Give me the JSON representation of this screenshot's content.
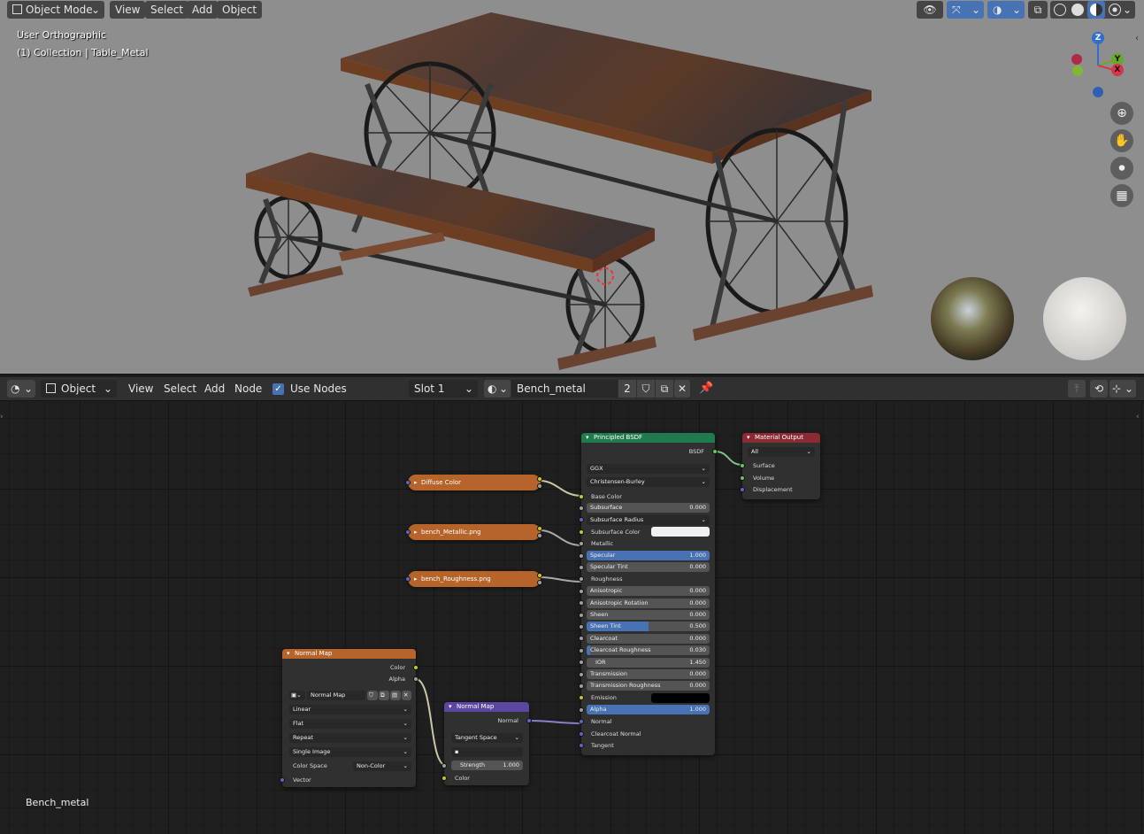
{
  "viewport": {
    "mode": "Object Mode",
    "menus": [
      "View",
      "Select",
      "Add",
      "Object"
    ],
    "view_name": "User Orthographic",
    "collection_info": "(1) Collection | Table_Metal",
    "gizmo": {
      "z": "Z",
      "y": "Y",
      "x": "X"
    }
  },
  "node_editor": {
    "type_value": "Object",
    "menus": [
      "View",
      "Select",
      "Add",
      "Node"
    ],
    "use_nodes_label": "Use Nodes",
    "slot": "Slot 1",
    "material_name": "Bench_metal",
    "user_count": "2",
    "footer_label": "Bench_metal"
  },
  "nodes": {
    "principled": {
      "title": "Principled BSDF",
      "output": "BSDF",
      "distribution": "GGX",
      "subsurface_method": "Christensen-Burley",
      "inputs": [
        {
          "label": "Base Color",
          "kind": "socket"
        },
        {
          "label": "Subsurface",
          "value": "0.000",
          "fill": 0
        },
        {
          "label": "Subsurface Radius",
          "kind": "dropdown"
        },
        {
          "label": "Subsurface Color",
          "kind": "color",
          "color": "#f2f2f2"
        },
        {
          "label": "Metallic",
          "kind": "socket"
        },
        {
          "label": "Specular",
          "value": "1.000",
          "fill": 1
        },
        {
          "label": "Specular Tint",
          "value": "0.000",
          "fill": 0
        },
        {
          "label": "Roughness",
          "kind": "socket"
        },
        {
          "label": "Anisotropic",
          "value": "0.000",
          "fill": 0
        },
        {
          "label": "Anisotropic Rotation",
          "value": "0.000",
          "fill": 0
        },
        {
          "label": "Sheen",
          "value": "0.000",
          "fill": 0
        },
        {
          "label": "Sheen Tint",
          "value": "0.500",
          "fill": 0.5
        },
        {
          "label": "Clearcoat",
          "value": "0.000",
          "fill": 0
        },
        {
          "label": "Clearcoat Roughness",
          "value": "0.030",
          "fill": 0.03
        },
        {
          "label": "IOR",
          "value": "1.450",
          "fill": 0
        },
        {
          "label": "Transmission",
          "value": "0.000",
          "fill": 0
        },
        {
          "label": "Transmission Roughness",
          "value": "0.000",
          "fill": 0
        },
        {
          "label": "Emission",
          "kind": "color",
          "color": "#000000"
        },
        {
          "label": "Alpha",
          "value": "1.000",
          "fill": 1
        },
        {
          "label": "Normal",
          "kind": "socket"
        },
        {
          "label": "Clearcoat Normal",
          "kind": "socket"
        },
        {
          "label": "Tangent",
          "kind": "socket"
        }
      ]
    },
    "material_output": {
      "title": "Material Output",
      "target": "All",
      "inputs": [
        "Surface",
        "Volume",
        "Displacement"
      ]
    },
    "diffuse": {
      "title": "Diffuse Color"
    },
    "metallic": {
      "title": "bench_Metallic.png"
    },
    "roughness": {
      "title": "bench_Roughness.png"
    },
    "image_texture": {
      "title": "Normal Map",
      "outputs": [
        "Color",
        "Alpha"
      ],
      "image": "Normal Map",
      "interpolation": "Linear",
      "projection": "Flat",
      "extension": "Repeat",
      "source": "Single Image",
      "color_space_label": "Color Space",
      "color_space": "Non-Color",
      "vector": "Vector"
    },
    "normal_map": {
      "title": "Normal Map",
      "output": "Normal",
      "space": "Tangent Space",
      "strength_label": "Strength",
      "strength": "1.000",
      "color": "Color"
    }
  },
  "colors": {
    "principled_header": "#1f7a4d",
    "output_header": "#8c2a33",
    "texture_header": "#b7642b",
    "vector_header": "#5b47a2",
    "accent_blue": "#4772b3"
  }
}
